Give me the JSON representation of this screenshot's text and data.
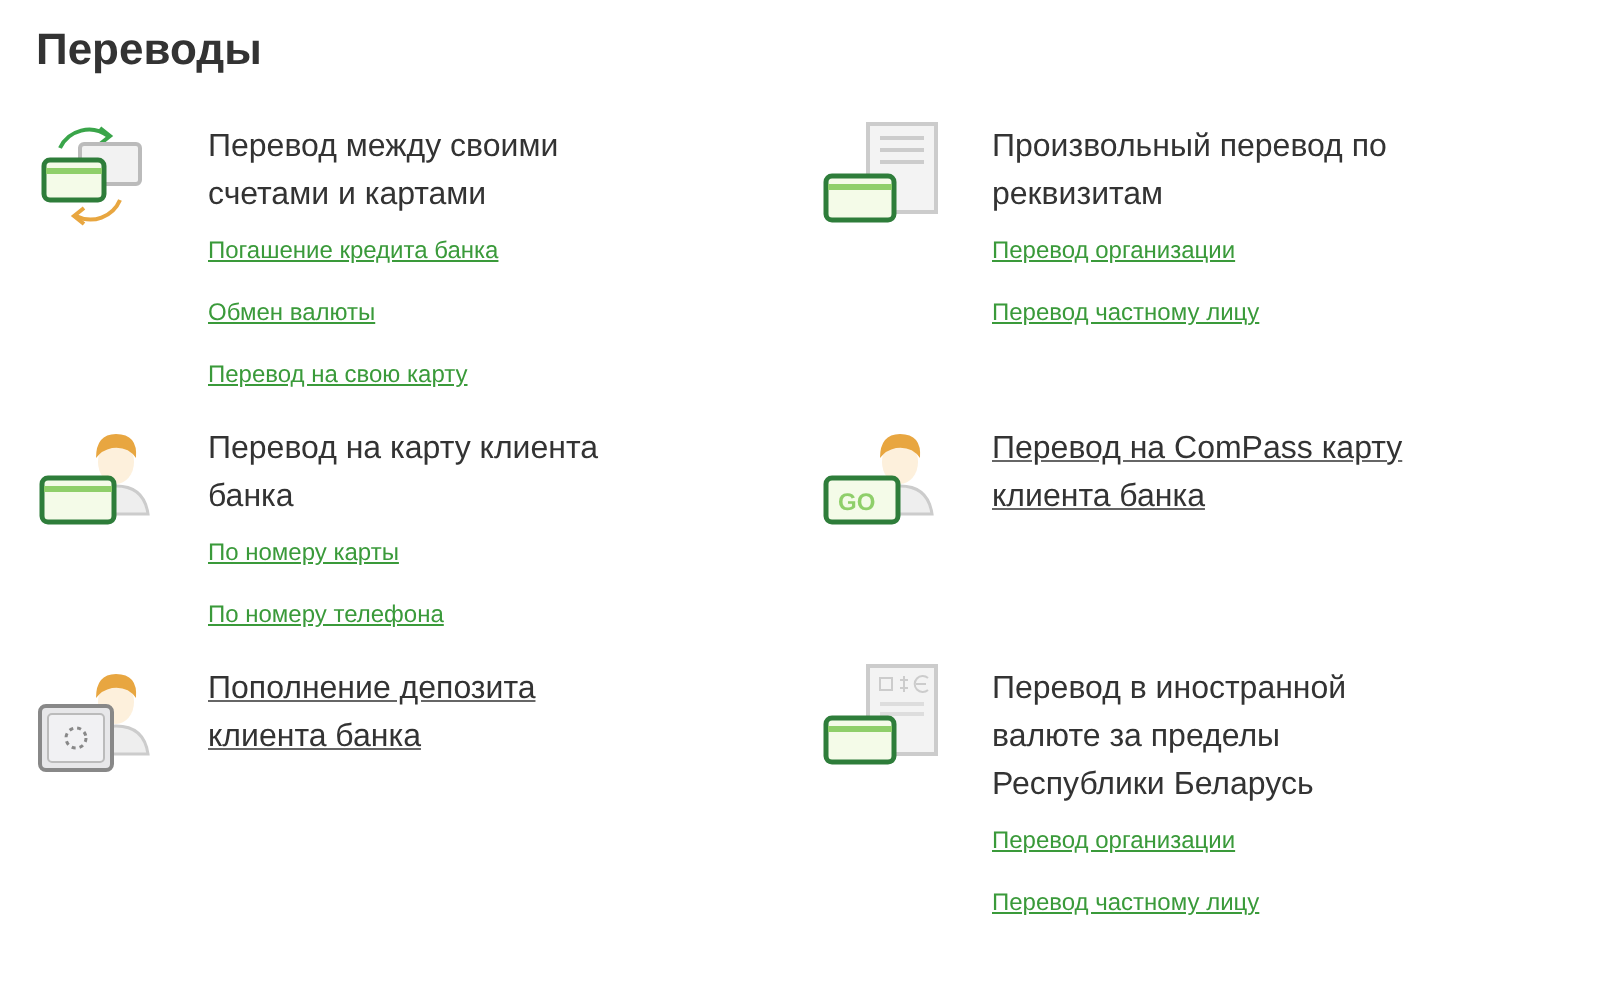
{
  "page_title": "Переводы",
  "items": [
    {
      "kind": "cards-exchange",
      "title": "Перевод между своими счетами и картами",
      "link": false,
      "links": [
        "Погашение кредита банка",
        "Обмен валюты",
        "Перевод на свою карту"
      ]
    },
    {
      "kind": "document-card",
      "title": "Произвольный перевод по реквизитам",
      "link": false,
      "links": [
        "Перевод организации",
        "Перевод частному лицу"
      ]
    },
    {
      "kind": "person-card",
      "title": "Перевод на карту клиента банка",
      "link": false,
      "links": [
        "По номеру карты",
        "По номеру телефона"
      ]
    },
    {
      "kind": "person-go",
      "icon_text": "GO",
      "title": "Перевод на ComPass карту клиента банка",
      "link": true
    },
    {
      "kind": "person-safe",
      "title": "Пополнение депозита клиента банка",
      "link": true
    },
    {
      "kind": "currency-document-card",
      "title": "Перевод в иностранной валюте за пределы Республики Беларусь",
      "link": false,
      "links": [
        "Перевод организации",
        "Перевод частному лицу"
      ]
    }
  ]
}
